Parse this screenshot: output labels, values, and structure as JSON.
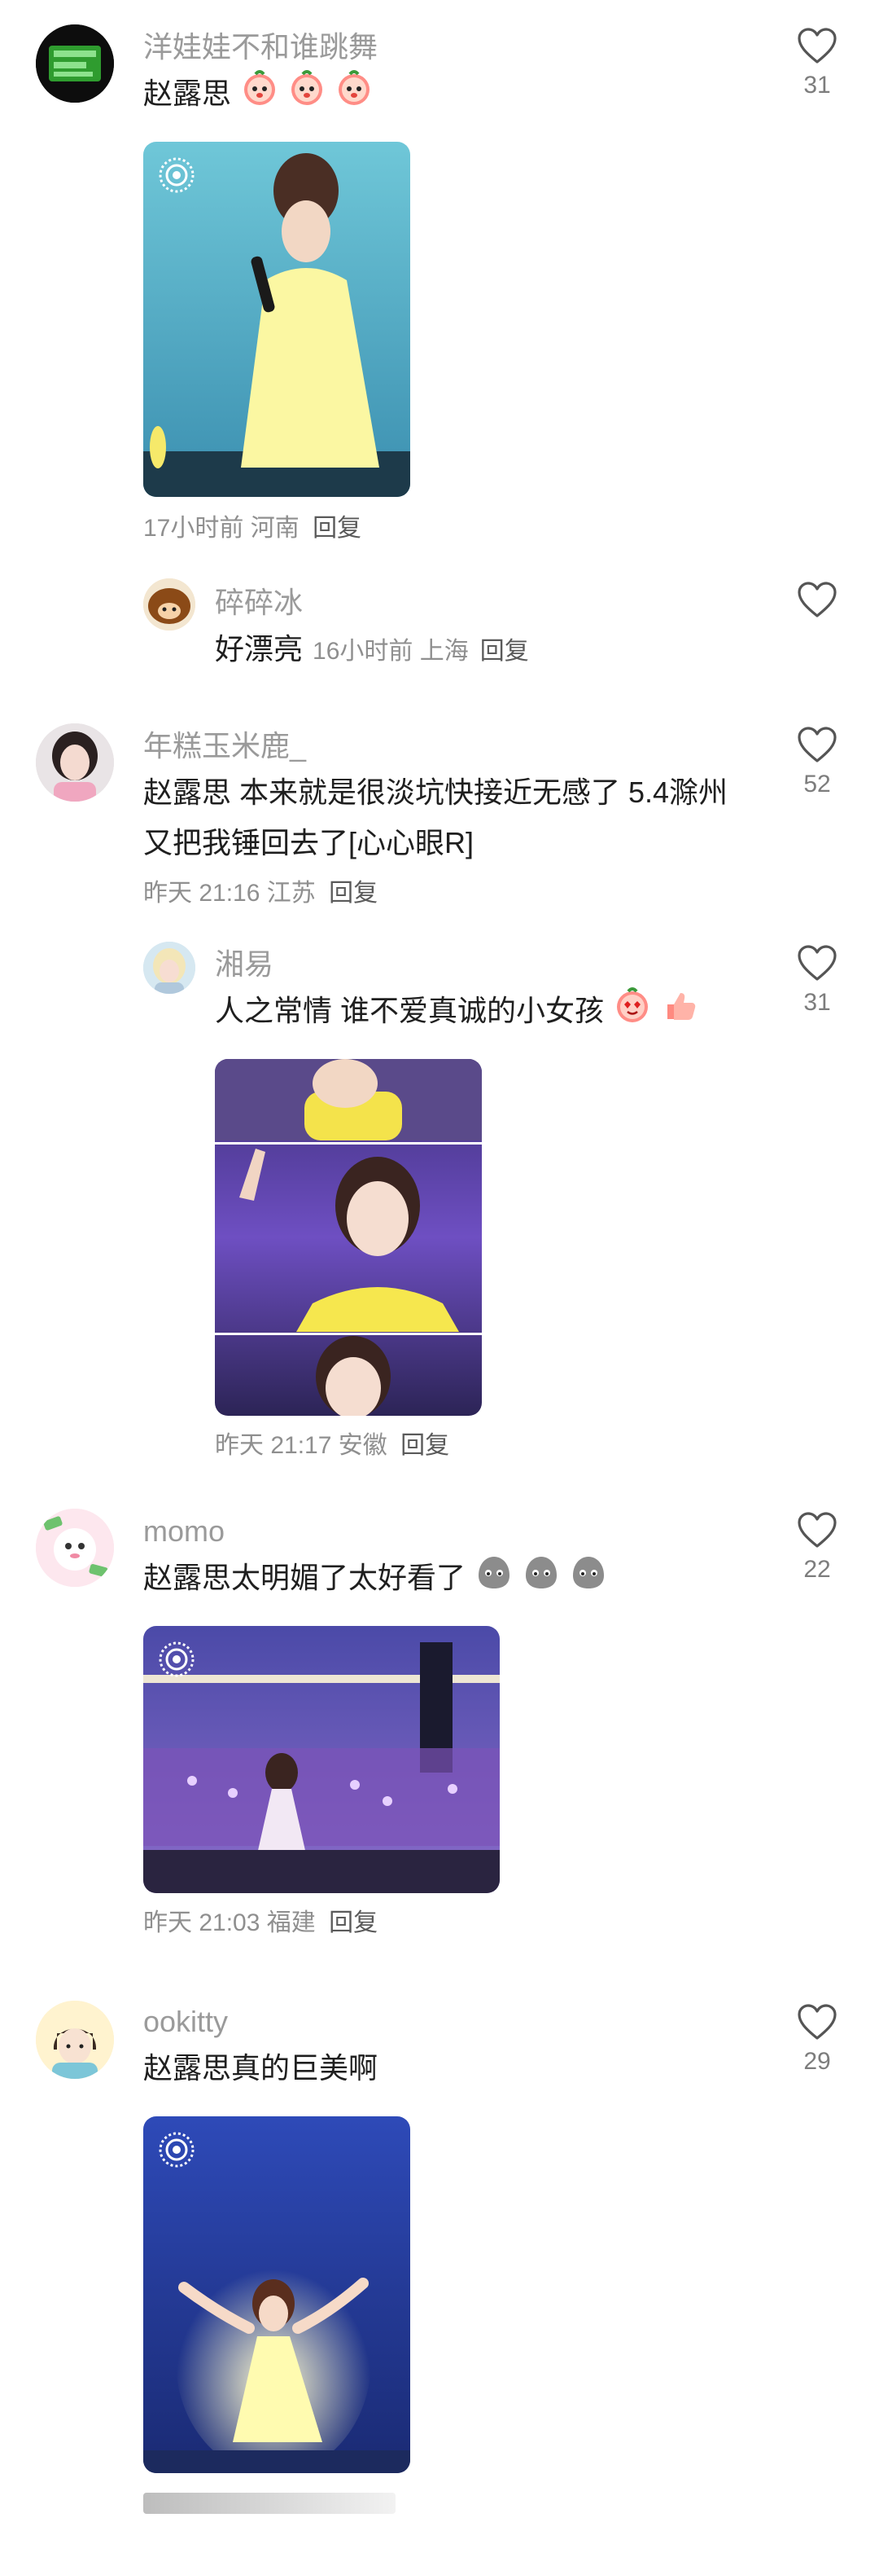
{
  "comments": [
    {
      "username": "洋娃娃不和谁跳舞",
      "text": "赵露思",
      "emojis": [
        "peach",
        "peach",
        "peach"
      ],
      "time_location": "17小时前 河南",
      "reply_label": "回复",
      "likes": "31"
    },
    {
      "username": "碎碎冰",
      "text": "好漂亮",
      "time_location": "16小时前 上海",
      "reply_label": "回复"
    },
    {
      "username": "年糕玉米鹿_",
      "text": "赵露思 本来就是很淡坑快接近无感了 5.4滁州又把我锤回去了[心心眼R]",
      "time_location": "昨天 21:16 江苏",
      "reply_label": "回复",
      "likes": "52"
    },
    {
      "username": "湘易",
      "text": "人之常情 谁不爱真诚的小女孩",
      "emojis": [
        "heart-eyes-peach",
        "thumbs-up"
      ],
      "time_location": "昨天 21:17 安徽",
      "reply_label": "回复",
      "likes": "31"
    },
    {
      "username": "momo",
      "text": "赵露思太明媚了太好看了",
      "emojis": [
        "grey-blob",
        "grey-blob",
        "grey-blob"
      ],
      "time_location": "昨天 21:03 福建",
      "reply_label": "回复",
      "likes": "22"
    },
    {
      "username": "ookitty",
      "text": "赵露思真的巨美啊",
      "likes": "29"
    }
  ],
  "colors": {
    "username": "#9a9a9a",
    "meta": "#8f8f8f",
    "heart_stroke": "#555555"
  }
}
